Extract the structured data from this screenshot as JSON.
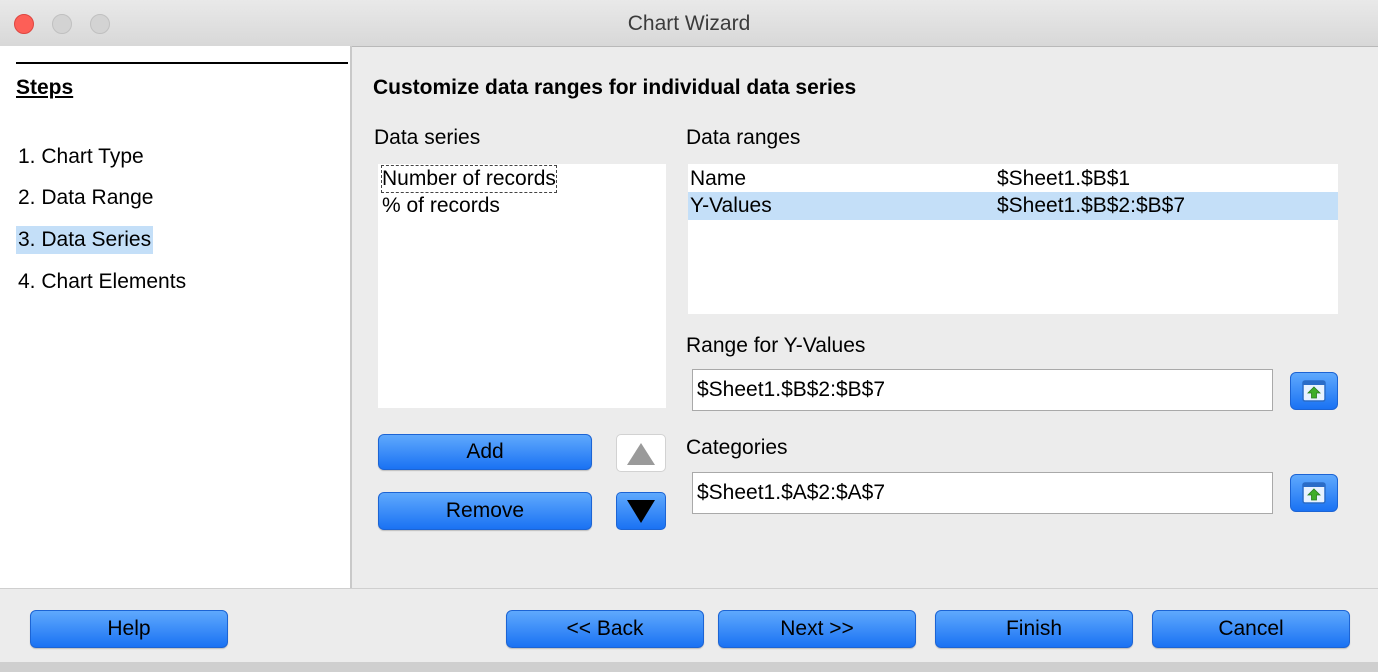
{
  "window": {
    "title": "Chart Wizard"
  },
  "sidebar": {
    "title": "Steps",
    "steps": [
      {
        "label": "1. Chart Type",
        "active": false
      },
      {
        "label": "2. Data Range",
        "active": false
      },
      {
        "label": "3. Data Series",
        "active": true
      },
      {
        "label": "4. Chart Elements",
        "active": false
      }
    ]
  },
  "main": {
    "heading": "Customize data ranges for individual data series",
    "data_series_label": "Data series",
    "data_series": [
      "Number of records",
      "% of records"
    ],
    "selected_series": "Number of records",
    "data_ranges_label": "Data ranges",
    "data_ranges": [
      {
        "name": "Name",
        "range": "$Sheet1.$B$1",
        "selected": false
      },
      {
        "name": "Y-Values",
        "range": "$Sheet1.$B$2:$B$7",
        "selected": true
      }
    ],
    "range_for_label": "Range for Y-Values",
    "range_for_value": "$Sheet1.$B$2:$B$7",
    "categories_label": "Categories",
    "categories_value": "$Sheet1.$A$2:$A$7",
    "add_label": "Add",
    "remove_label": "Remove"
  },
  "footer": {
    "help_label": "Help",
    "back_label": "<< Back",
    "next_label": "Next >>",
    "finish_label": "Finish",
    "cancel_label": "Cancel"
  }
}
